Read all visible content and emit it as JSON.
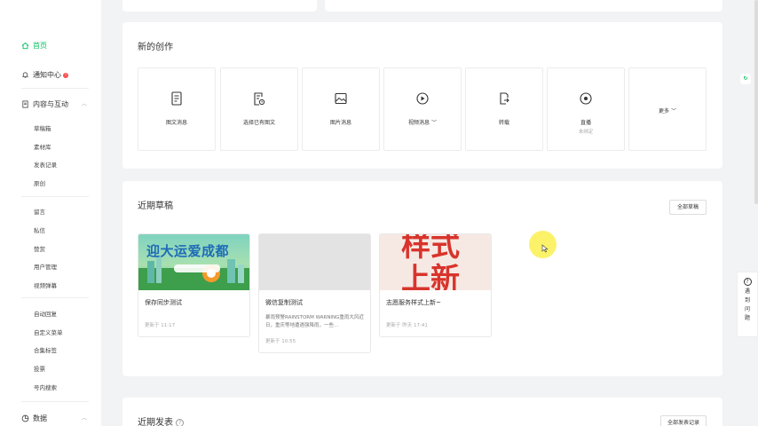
{
  "sidebar": {
    "home": "首页",
    "notifications": "通知中心",
    "content_group": "内容与互动",
    "content_items": [
      "草稿箱",
      "素材库",
      "发表记录",
      "原创"
    ],
    "interaction_items": [
      "留言",
      "私信",
      "赞赏",
      "用户管理",
      "视频弹幕"
    ],
    "function_items": [
      "自动回复",
      "自定义菜单",
      "合集标签",
      "投票",
      "号内搜索"
    ],
    "data_group": "数据"
  },
  "create": {
    "title": "新的创作",
    "tiles": [
      {
        "label": "图文消息",
        "icon": "document-icon"
      },
      {
        "label": "选择已有图文",
        "icon": "document-select-icon"
      },
      {
        "label": "图片消息",
        "icon": "image-icon"
      },
      {
        "label": "视频消息",
        "icon": "video-play-icon"
      },
      {
        "label": "转载",
        "icon": "repost-icon"
      },
      {
        "label": "直播",
        "sub": "未绑定",
        "icon": "live-icon"
      },
      {
        "label": "更多"
      }
    ]
  },
  "drafts": {
    "title": "近期草稿",
    "all_button": "全部草稿",
    "items": [
      {
        "title": "保存同步测试",
        "meta": "更新于 11:17",
        "thumb_text": "迎大运爱成都"
      },
      {
        "title": "微信复制测试",
        "desc": "暴雨预警RAINSTORM WARNING重雨大风近日，重庆等地遭遇强降雨，一些...",
        "meta": "更新于 10:55"
      },
      {
        "title": "志愿服务样式上新~",
        "meta": "更新于 昨天 17:41",
        "thumb_text": "样式上新"
      }
    ]
  },
  "published": {
    "title": "近期发表",
    "all_button": "全部发表记录"
  },
  "help": {
    "label": "遇到问题"
  },
  "colors": {
    "accent": "#07c160",
    "badge": "#fa5151"
  }
}
